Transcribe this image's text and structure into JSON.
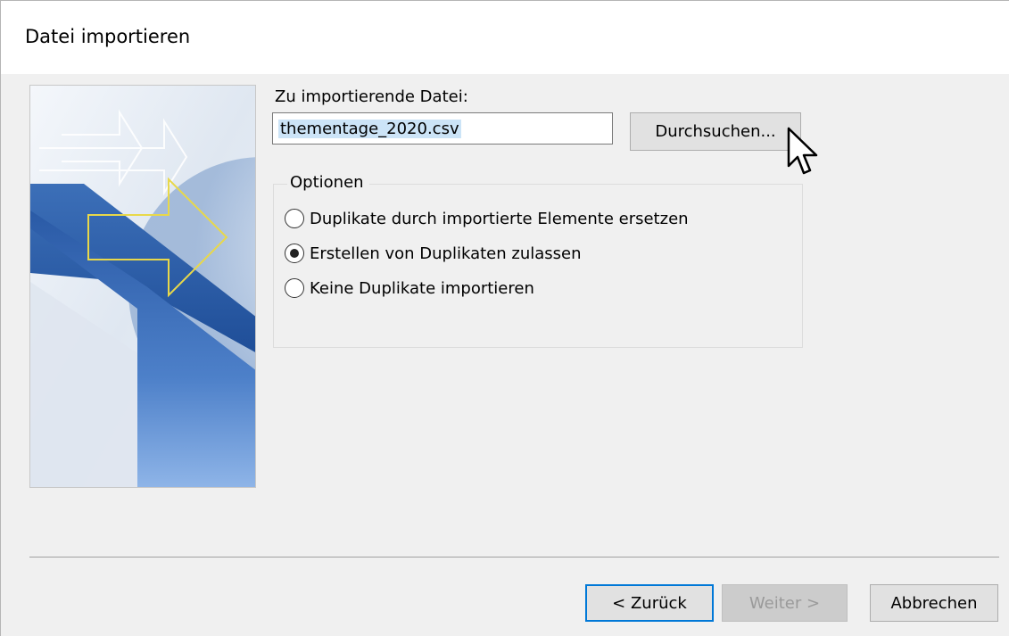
{
  "window": {
    "title": "Datei importieren"
  },
  "file": {
    "label": "Zu importierende Datei:",
    "value": "thementage_2020.csv",
    "browse_label": "Durchsuchen..."
  },
  "options": {
    "legend": "Optionen",
    "items": [
      {
        "label": "Duplikate durch importierte Elemente ersetzen",
        "checked": false
      },
      {
        "label": "Erstellen von Duplikaten zulassen",
        "checked": true
      },
      {
        "label": "Keine Duplikate importieren",
        "checked": false
      }
    ]
  },
  "footer": {
    "back_label": "< Zurück",
    "next_label": "Weiter >",
    "cancel_label": "Abbrechen"
  },
  "icons": {
    "banner": "import-arrows-graphic",
    "cursor": "mouse-pointer-icon"
  },
  "colors": {
    "accent": "#0078d7",
    "selection": "#cce4f7",
    "banner_blue": "#2b5aa5"
  }
}
